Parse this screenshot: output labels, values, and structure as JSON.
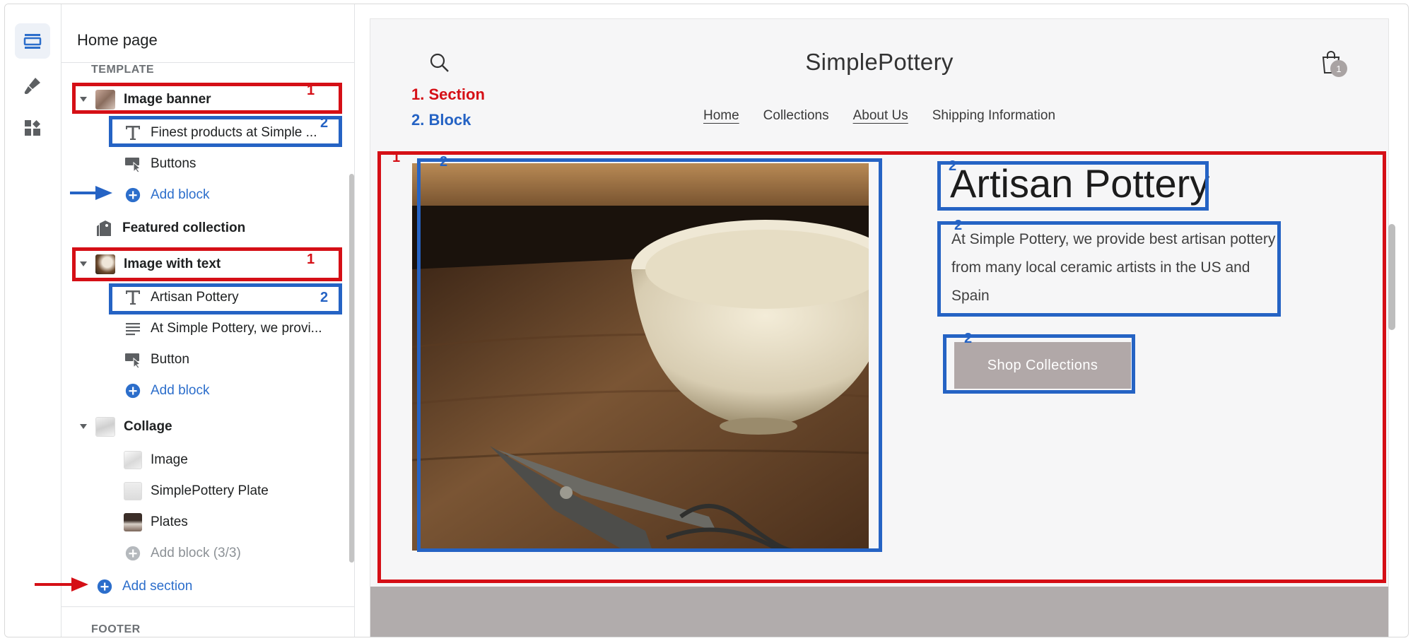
{
  "sidebar": {
    "title": "Home page",
    "template_label": "TEMPLATE",
    "footer_label": "FOOTER",
    "items": {
      "image_banner": "Image banner",
      "finest_products": "Finest products at Simple ...",
      "buttons": "Buttons",
      "add_block_1": "Add block",
      "featured_collection": "Featured collection",
      "image_with_text": "Image with text",
      "artisan_pottery": "Artisan Pottery",
      "at_simple_pottery": "At Simple Pottery, we provi...",
      "button": "Button",
      "add_block_2": "Add block",
      "collage": "Collage",
      "image": "Image",
      "plate": "SimplePottery Plate",
      "plates": "Plates",
      "add_block_3": "Add block (3/3)",
      "add_section": "Add section"
    }
  },
  "annotations": {
    "one": "1",
    "two": "2",
    "legend_section": "1. Section",
    "legend_block": "2. Block"
  },
  "preview": {
    "store_name": "SimplePottery",
    "cart_count": "1",
    "nav": [
      "Home",
      "Collections",
      "About Us",
      "Shipping Information"
    ],
    "heading": "Artisan Pottery",
    "paragraph": "At Simple Pottery, we provide best artisan pottery from many local ceramic artists in the US and Spain",
    "button_label": "Shop Collections"
  },
  "colors": {
    "annotation_red": "#d50f16",
    "annotation_blue": "#2563c4",
    "link_blue": "#2c6ecb",
    "button_bg": "#b1a8a8"
  },
  "icons": {
    "rail": [
      "sections-icon",
      "theme-settings-icon",
      "app-blocks-icon"
    ],
    "header": [
      "search-icon",
      "cart-icon"
    ]
  }
}
